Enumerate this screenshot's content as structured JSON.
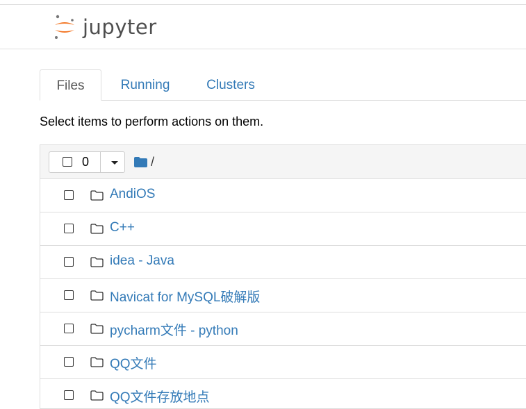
{
  "header": {
    "logo_text": "jupyter"
  },
  "tabs": [
    {
      "label": "Files"
    },
    {
      "label": "Running"
    },
    {
      "label": "Clusters"
    }
  ],
  "hint": "Select items to perform actions on them.",
  "list_header": {
    "selected_count": "0",
    "path": "/"
  },
  "items": [
    {
      "name": "AndiOS"
    },
    {
      "name": "C++"
    },
    {
      "name": "idea - Java"
    },
    {
      "name": "Navicat for MySQL破解版"
    },
    {
      "name": "pycharm文件 - python"
    },
    {
      "name": "QQ文件"
    },
    {
      "name": "QQ文件存放地点"
    }
  ],
  "colors": {
    "link": "#337ab7",
    "logo_orange": "#f37726",
    "logo_gray": "#767677",
    "border": "#dddddd"
  }
}
